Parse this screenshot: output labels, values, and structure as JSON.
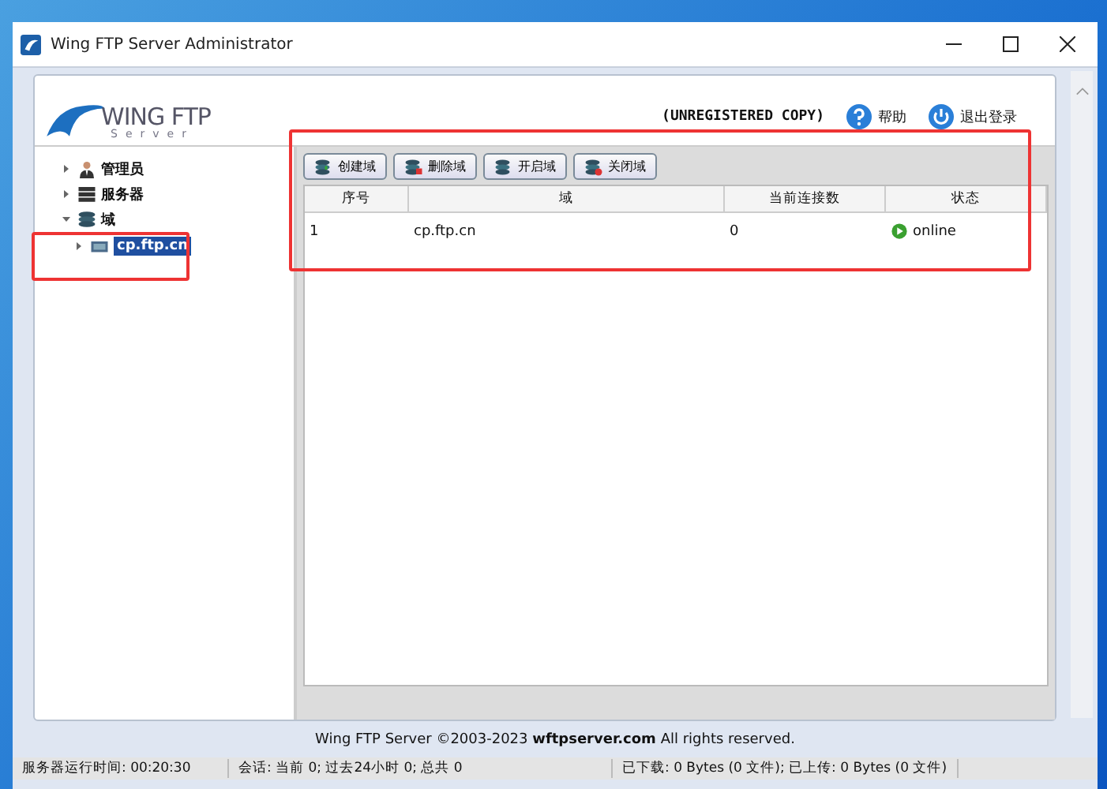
{
  "window": {
    "title": "Wing FTP Server Administrator"
  },
  "logo": {
    "name": "WING FTP",
    "sub": "Server"
  },
  "header": {
    "notice": "(UNREGISTERED COPY)",
    "links": [
      {
        "kind": "help",
        "label": "帮助"
      },
      {
        "kind": "logout",
        "label": "退出登录"
      }
    ]
  },
  "tree": [
    {
      "kind": "admin",
      "label": "管理员",
      "expanded": false,
      "selected": false
    },
    {
      "kind": "server",
      "label": "服务器",
      "expanded": false,
      "selected": false
    },
    {
      "kind": "domain",
      "label": "域",
      "expanded": true,
      "selected": false,
      "children": [
        {
          "kind": "domain-item",
          "label": "cp.ftp.cn",
          "expanded": false,
          "selected": true
        }
      ]
    }
  ],
  "toolbar": [
    {
      "kind": "create",
      "label": "创建域"
    },
    {
      "kind": "delete",
      "label": "删除域"
    },
    {
      "kind": "start",
      "label": "开启域"
    },
    {
      "kind": "stop",
      "label": "关闭域"
    }
  ],
  "table": {
    "columns": [
      "序号",
      "域",
      "当前连接数",
      "状态"
    ],
    "rows": [
      {
        "cells": [
          "1",
          "cp.ftp.cn",
          "0",
          "online"
        ],
        "online": true
      }
    ]
  },
  "footer": "Wing FTP Server ©2003-2023 **wftpserver.com** All rights reserved.",
  "status_bar": [
    "服务器运行时间: 00:20:30",
    "会话: 当前 0;  过去24小时 0;  总共 0",
    "已下载: 0 Bytes (0 文件);  已上传: 0 Bytes (0 文件)"
  ]
}
